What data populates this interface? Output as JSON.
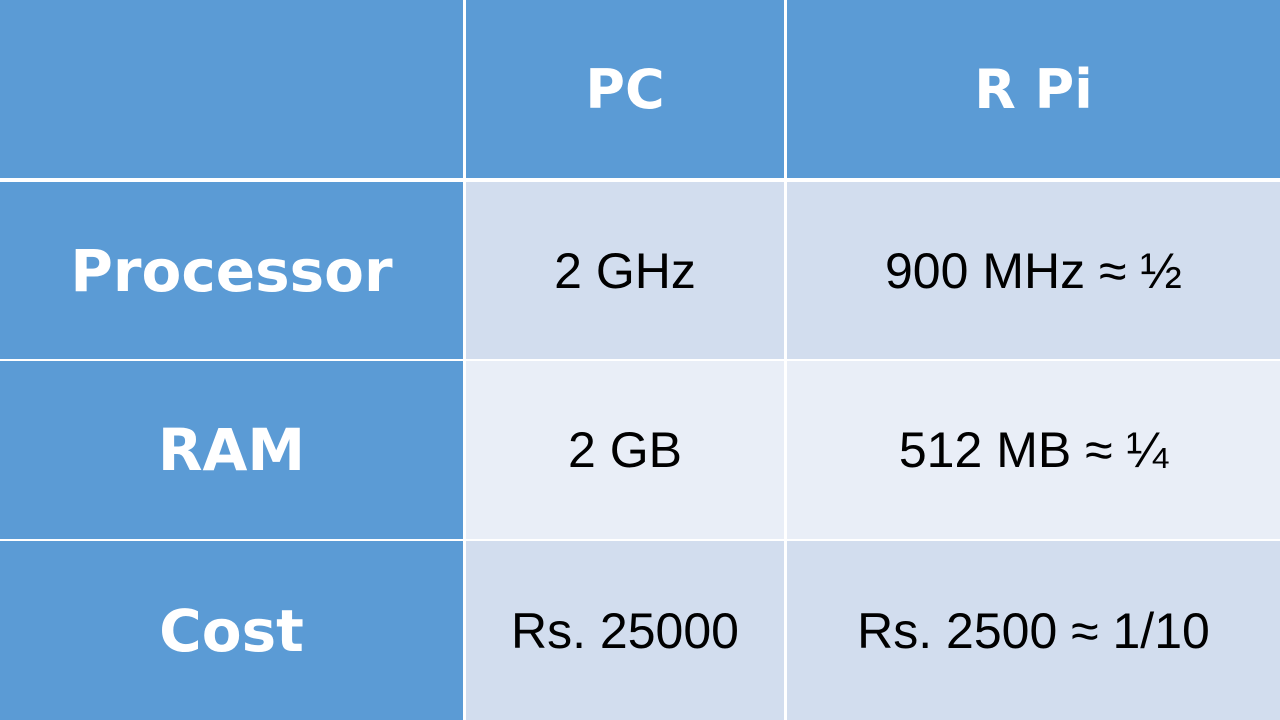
{
  "table": {
    "columns": [
      "",
      "PC",
      "R Pi"
    ],
    "rows": [
      {
        "label": "Processor",
        "pc": "2 GHz",
        "rpi": "900 MHz ≈  ½"
      },
      {
        "label": "RAM",
        "pc": "2 GB",
        "rpi": "512 MB ≈ ¼"
      },
      {
        "label": "Cost",
        "pc": "Rs. 25000",
        "rpi": "Rs. 2500 ≈ 1/10"
      }
    ]
  },
  "colors": {
    "header_bg": "#5b9bd5",
    "row_band_dark": "#d2ddee",
    "row_band_light": "#e9eef7",
    "header_text": "#ffffff",
    "body_text": "#000000"
  }
}
